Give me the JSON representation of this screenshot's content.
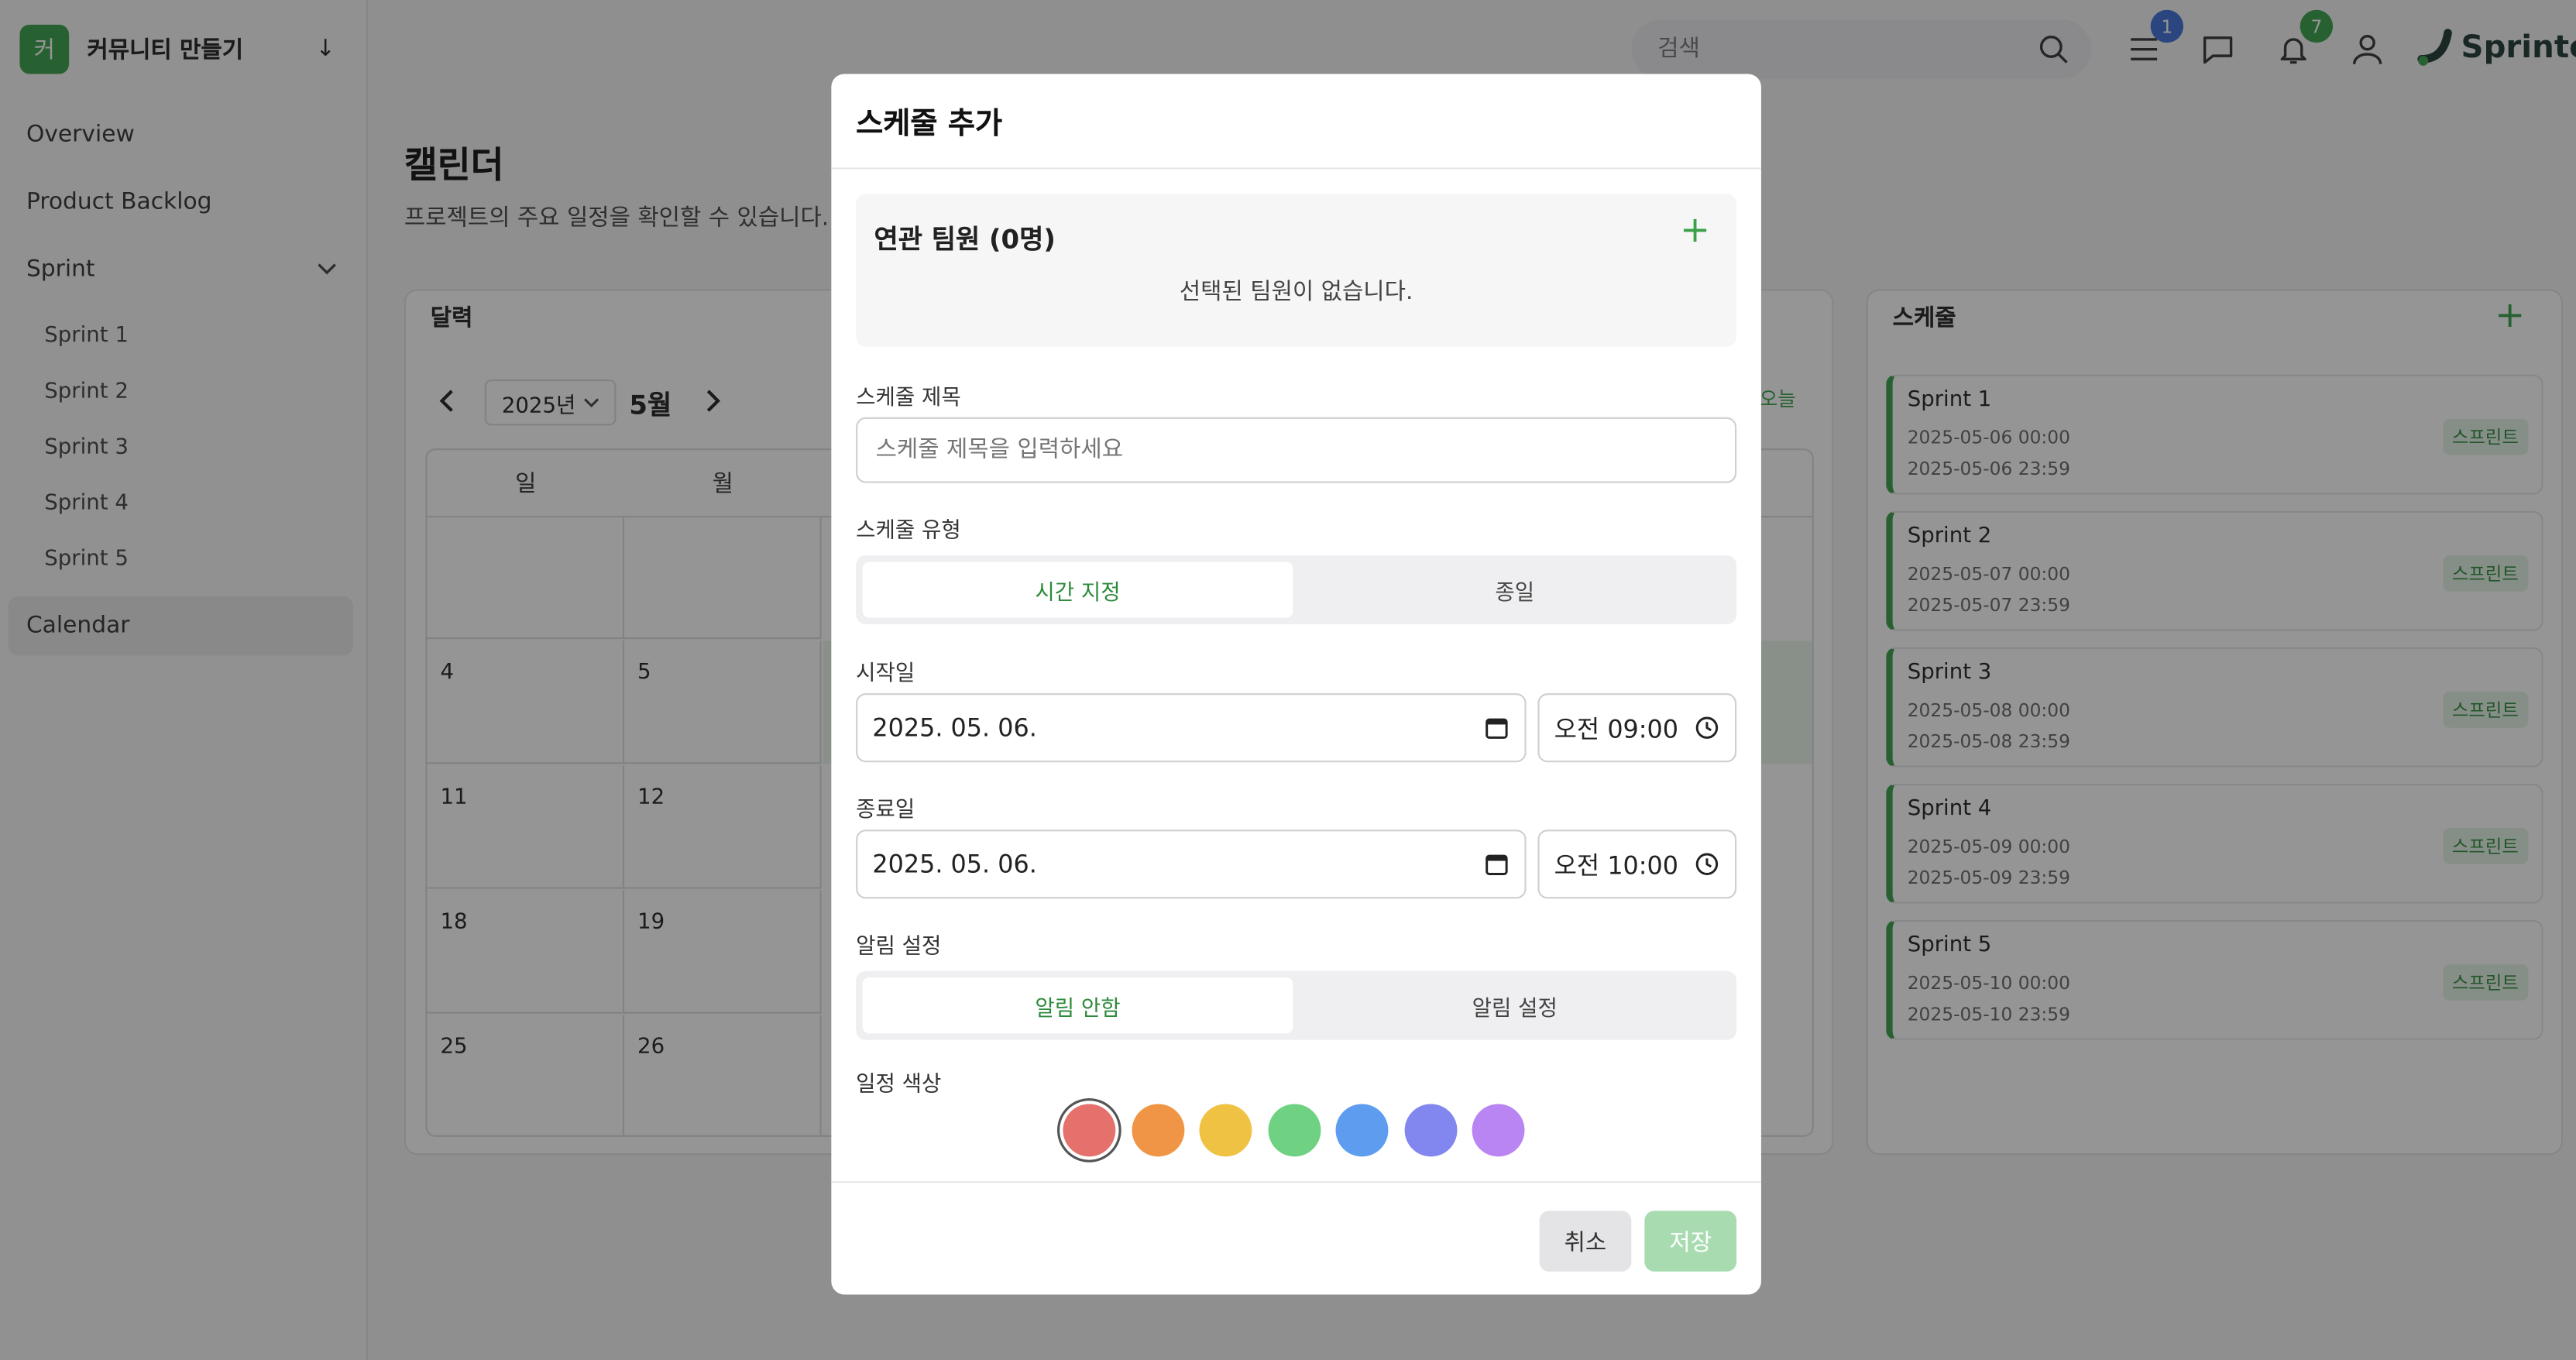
{
  "workspace": {
    "badge": "커",
    "name": "커뮤니티 만들기"
  },
  "sidebar": {
    "items": [
      {
        "label": "Overview"
      },
      {
        "label": "Product Backlog"
      },
      {
        "label": "Sprint"
      }
    ],
    "sprints": [
      {
        "label": "Sprint 1"
      },
      {
        "label": "Sprint 2"
      },
      {
        "label": "Sprint 3"
      },
      {
        "label": "Sprint 4"
      },
      {
        "label": "Sprint 5"
      }
    ],
    "calendar": {
      "label": "Calendar"
    }
  },
  "header": {
    "search_placeholder": "검색",
    "menu_badge": "1",
    "notif_badge": "7",
    "logo": "Sprinter"
  },
  "page": {
    "title": "캘린더",
    "subtitle": "프로젝트의 주요 일정을 확인할 수 있습니다."
  },
  "calendar": {
    "title": "달력",
    "year": "2025년",
    "month": "5월",
    "today": "오늘",
    "dow": [
      "일",
      "월"
    ],
    "rows": [
      [
        "",
        ""
      ],
      [
        "4",
        "5"
      ],
      [
        "11",
        "12"
      ],
      [
        "18",
        "19"
      ],
      [
        "25",
        "26"
      ]
    ]
  },
  "schedule": {
    "title": "스케줄",
    "items": [
      {
        "name": "Sprint 1",
        "start": "2025-05-06 00:00",
        "end": "2025-05-06 23:59",
        "tag": "스프린트"
      },
      {
        "name": "Sprint 2",
        "start": "2025-05-07 00:00",
        "end": "2025-05-07 23:59",
        "tag": "스프린트"
      },
      {
        "name": "Sprint 3",
        "start": "2025-05-08 00:00",
        "end": "2025-05-08 23:59",
        "tag": "스프린트"
      },
      {
        "name": "Sprint 4",
        "start": "2025-05-09 00:00",
        "end": "2025-05-09 23:59",
        "tag": "스프린트"
      },
      {
        "name": "Sprint 5",
        "start": "2025-05-10 00:00",
        "end": "2025-05-10 23:59",
        "tag": "스프린트"
      }
    ]
  },
  "modal": {
    "title": "스케줄 추가",
    "members_title": "연관 팀원 (0명)",
    "members_empty": "선택된 팀원이 없습니다.",
    "title_label": "스케줄 제목",
    "title_placeholder": "스케줄 제목을 입력하세요",
    "type_label": "스케줄 유형",
    "type_options": [
      "시간 지정",
      "종일"
    ],
    "start_label": "시작일",
    "start_date": "2025. 05. 06.",
    "start_time": "오전 09:00",
    "end_label": "종료일",
    "end_date": "2025. 05. 06.",
    "end_time": "오전 10:00",
    "alarm_label": "알림 설정",
    "alarm_options": [
      "알림 안함",
      "알림 설정"
    ],
    "color_label": "일정 색상",
    "colors": [
      "#e5716c",
      "#ef9545",
      "#f0c243",
      "#6fd282",
      "#5e9cf0",
      "#8187ee",
      "#b985f3"
    ],
    "cancel": "취소",
    "save": "저장"
  }
}
